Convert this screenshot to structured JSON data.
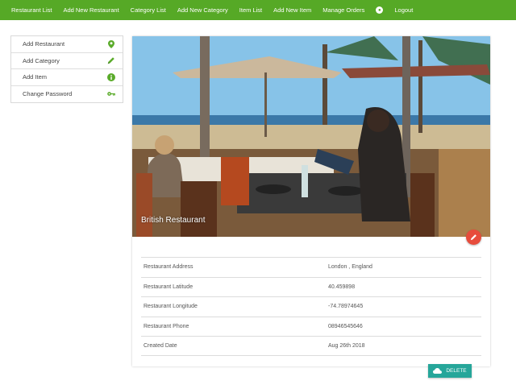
{
  "nav": {
    "items": [
      {
        "label": "Restaurant List"
      },
      {
        "label": "Add New Restaurant"
      },
      {
        "label": "Category List"
      },
      {
        "label": "Add New Category"
      },
      {
        "label": "Item List"
      },
      {
        "label": "Add New Item"
      },
      {
        "label": "Manage Orders"
      }
    ],
    "globe_icon": "globe-icon",
    "logout_label": "Logout"
  },
  "sidebar": {
    "items": [
      {
        "label": "Add Restaurant",
        "icon": "map-pin-icon"
      },
      {
        "label": "Add Category",
        "icon": "pencil-icon"
      },
      {
        "label": "Add Item",
        "icon": "info-icon"
      },
      {
        "label": "Change Password",
        "icon": "key-icon"
      }
    ]
  },
  "restaurant": {
    "name": "British Restaurant",
    "details": [
      {
        "label": "Restaurant Address",
        "value": "London , England"
      },
      {
        "label": "Restaurant Latitude",
        "value": "40.459898"
      },
      {
        "label": "Restaurant Longitude",
        "value": "-74.78974645"
      },
      {
        "label": "Restaurant Phone",
        "value": "08946545646"
      },
      {
        "label": "Created Date",
        "value": "Aug 26th 2018"
      }
    ]
  },
  "actions": {
    "delete_label": "DELETE",
    "delete_icon": "cloud-icon",
    "edit_icon": "pencil-icon"
  },
  "colors": {
    "nav_bg": "#56a926",
    "accent_green": "#5aab2a",
    "fab_red": "#e74c3c",
    "delete_teal": "#26a69a"
  }
}
